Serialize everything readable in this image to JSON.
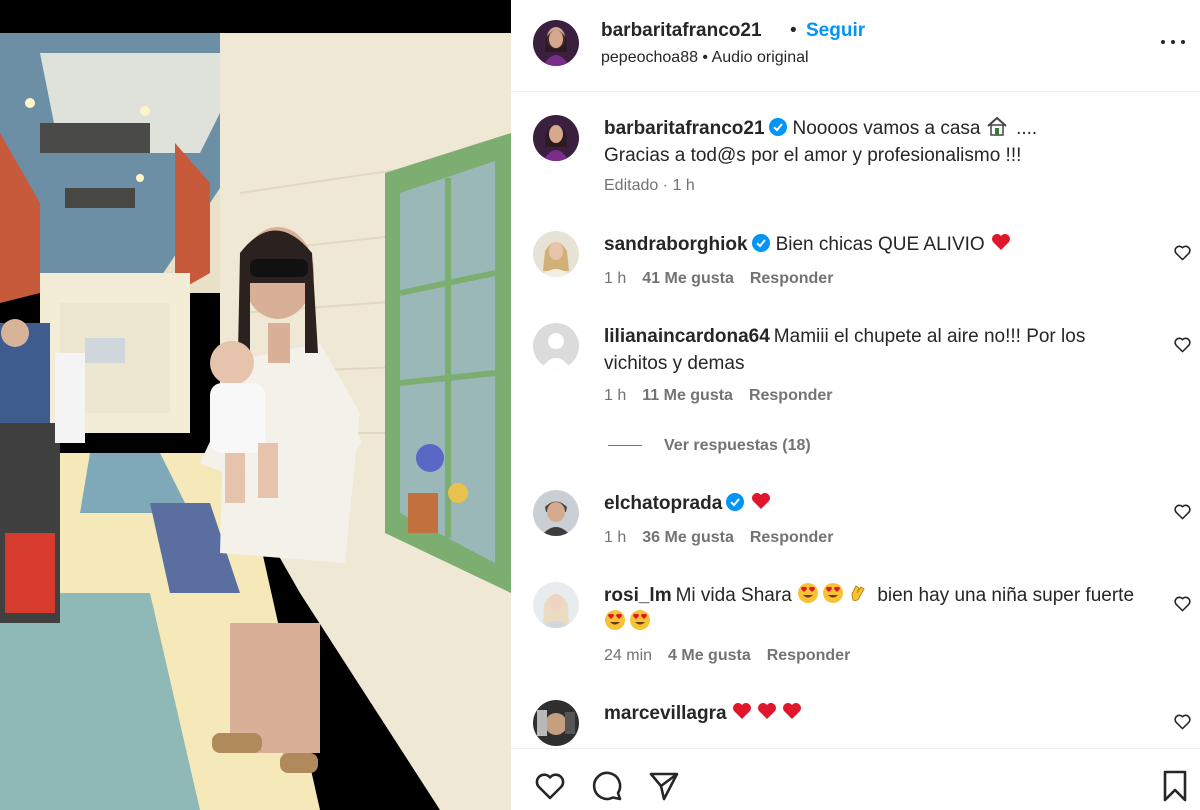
{
  "post": {
    "author": "barbaritafranco21",
    "separator": "•",
    "follow_label": "Seguir",
    "audio_line": "pepeochoa88 • Audio original"
  },
  "caption": {
    "username": "barbaritafranco21",
    "text_line1": "Nooоos vamos a casa",
    "text_line1_suffix": "....",
    "text_line2": "Gracias a tod@s por el amor y profesionalismo !!!",
    "edited": "Editado · 1 h"
  },
  "comments": [
    {
      "username": "sandraborghiok",
      "verified": true,
      "text": "Bien chicas QUE ALIVIO",
      "time": "1 h",
      "likes": "41 Me gusta",
      "reply": "Responder"
    },
    {
      "username": "lilianaincardona64",
      "verified": false,
      "text": "Mamiii el chupete al aire no!!! Por los",
      "text2": "vichitos y demas",
      "time": "1 h",
      "likes": "11 Me gusta",
      "reply": "Responder",
      "view_replies": "Ver respuestas (18)"
    },
    {
      "username": "elchatoprada",
      "verified": true,
      "text": "",
      "time": "1 h",
      "likes": "36 Me gusta",
      "reply": "Responder"
    },
    {
      "username": "rosi_lm",
      "verified": false,
      "text": "Mi vida Shara",
      "text_after": "bien hay una niña super fuerte",
      "time": "24 min",
      "likes": "4 Me gusta",
      "reply": "Responder"
    },
    {
      "username": "marcevillagra",
      "verified": false,
      "text": ""
    }
  ],
  "icons": {
    "like": "heart-icon",
    "comment": "comment-bubble-icon",
    "share": "paper-plane-icon",
    "save": "bookmark-icon",
    "more": "more-options-icon"
  },
  "colors": {
    "link": "#0095f6",
    "verified": "#0095f6",
    "heart_emoji": "#e0162b",
    "secondary_text": "#737373"
  }
}
